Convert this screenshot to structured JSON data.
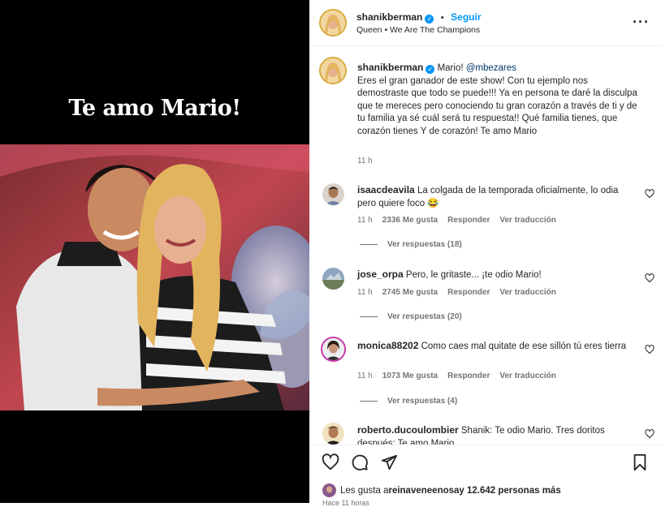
{
  "post": {
    "headline": "Te amo Mario!"
  },
  "header": {
    "username": "shanikberman",
    "dot": "•",
    "follow_label": "Seguir",
    "audio": "Queen • We Are The Champions",
    "more_icon": "more-horizontal-icon"
  },
  "caption": {
    "username": "shanikberman",
    "mention_prefix": "Mario! ",
    "mention": "@mbezares",
    "text": "Eres el gran ganador de este show! Con tu ejemplo nos demostraste que todo se puede!!! Ya en persona te daré la disculpa que te mereces pero conociendo tu gran corazón a través de ti y de tu familia ya sé cuál será tu respuesta!! Qué familia tienes, que corazón tienes Y de corazón! Te amo Mario",
    "time": "11 h"
  },
  "comments": [
    {
      "username": "isaacdeavila",
      "text": "La colgada de la temporada oficialmente, lo odia pero quiere foco 😂",
      "time": "11 h",
      "likes": "2336 Me gusta",
      "reply": "Responder",
      "translate": "Ver traducción",
      "replies": "Ver respuestas (18)"
    },
    {
      "username": "jose_orpa",
      "text": "Pero, le gritaste... ¡te odio Mario!",
      "time": "11 h",
      "likes": "2745 Me gusta",
      "reply": "Responder",
      "translate": "Ver traducción",
      "replies": "Ver respuestas (20)"
    },
    {
      "username": "monica88202",
      "text": "Como caes mal quitate de ese sillón tú eres tierra",
      "time": "11 h",
      "likes": "1073 Me gusta",
      "reply": "Responder",
      "translate": "Ver traducción",
      "replies": "Ver respuestas (4)"
    },
    {
      "username": "roberto.ducoulombier",
      "text": "Shanik: Te odio Mario. Tres doritos después: Te amo Mario"
    }
  ],
  "actions": {
    "like_icon": "heart-icon",
    "comment_icon": "comment-icon",
    "share_icon": "send-icon",
    "save_icon": "bookmark-icon",
    "likes_prefix": "Les gusta a ",
    "likes_user": "reinaveneenosa",
    "likes_suffix": " y 12.642 personas más",
    "date": "Hace 11 horas"
  },
  "colors": {
    "accent": "#0095f6",
    "text": "#262626",
    "muted": "#737373",
    "media_bg": "#000000"
  }
}
